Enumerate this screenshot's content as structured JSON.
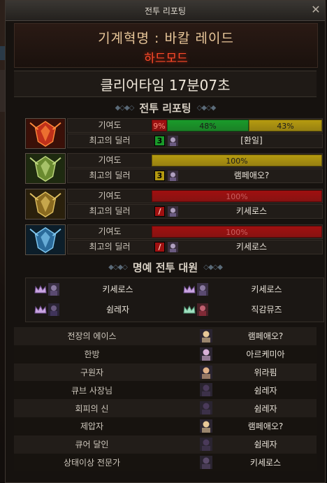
{
  "window": {
    "title": "전투 리포팅",
    "close_glyph": "✕"
  },
  "raid": {
    "name": "기계혁명 : 바칼 레이드",
    "mode": "하드모드"
  },
  "clear_time": "클리어타임  17분07초",
  "sections": {
    "report": "전투 리포팅",
    "honor": "명예 전투 대원"
  },
  "colors": {
    "green": "#1a9a2a",
    "yellow": "#b59a10",
    "red": "#a01010",
    "accent": "#ff4a2a"
  },
  "contribution": {
    "label": "기여도",
    "dealer_label": "최고의 딜러",
    "rows": [
      {
        "icon": "red-dragon-icon",
        "segments": [
          {
            "text": "9%",
            "pct": 9,
            "color": "red"
          },
          {
            "text": "48%",
            "pct": 48,
            "color": "green"
          },
          {
            "text": "43%",
            "pct": 43,
            "color": "yellow"
          }
        ],
        "dealer_badge": "3",
        "dealer_badge_color": "green",
        "dealer_name": "[환일]"
      },
      {
        "icon": "green-dragon-icon",
        "segments": [
          {
            "text": "100%",
            "pct": 100,
            "color": "yellow"
          }
        ],
        "dealer_badge": "3",
        "dealer_badge_color": "yellow",
        "dealer_name": "램페애오?"
      },
      {
        "icon": "gold-dragon-icon",
        "segments": [
          {
            "text": "100%",
            "pct": 100,
            "color": "red"
          }
        ],
        "dealer_badge": "/",
        "dealer_badge_color": "red",
        "dealer_name": "키세로스"
      },
      {
        "icon": "blue-dragon-icon",
        "segments": [
          {
            "text": "100%",
            "pct": 100,
            "color": "red"
          }
        ],
        "dealer_badge": "/",
        "dealer_badge_color": "red",
        "dealer_name": "키세로스"
      }
    ]
  },
  "honor_members": [
    {
      "name": "키세로스"
    },
    {
      "name": "키세로스"
    },
    {
      "name": "쉼레자"
    },
    {
      "name": "직감뮤즈"
    }
  ],
  "titles": [
    {
      "title": "전장의 에이스",
      "name": "램페애오?"
    },
    {
      "title": "한방",
      "name": "아르케미아"
    },
    {
      "title": "구원자",
      "name": "위라핌"
    },
    {
      "title": "큐브 사장님",
      "name": "쉼레자"
    },
    {
      "title": "회피의 신",
      "name": "쉼레자"
    },
    {
      "title": "제압자",
      "name": "램페애오?"
    },
    {
      "title": "큐어 달인",
      "name": "쉼레자"
    },
    {
      "title": "상태이상 전문가",
      "name": "키세로스"
    }
  ]
}
